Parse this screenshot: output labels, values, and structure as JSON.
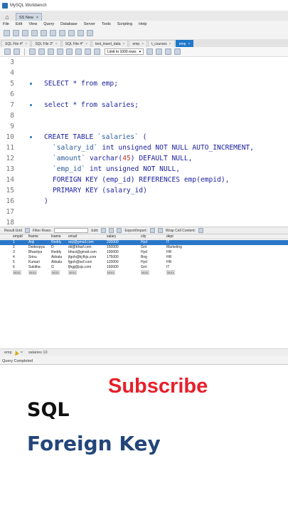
{
  "window": {
    "title": "MySQL Workbench"
  },
  "connection_tab": {
    "label": "SS New",
    "close": "×"
  },
  "menu": [
    "File",
    "Edit",
    "View",
    "Query",
    "Database",
    "Server",
    "Tools",
    "Scripting",
    "Help"
  ],
  "editor_tabs": [
    {
      "label": "SQL File 4*",
      "active": false
    },
    {
      "label": "SQL File 3*",
      "active": false
    },
    {
      "label": "SQL File 4*",
      "active": false
    },
    {
      "label": "test_insert_data",
      "active": false
    },
    {
      "label": "emp",
      "active": false
    },
    {
      "label": "t_courses",
      "active": false
    },
    {
      "label": "emp",
      "active": true
    }
  ],
  "limit_select": {
    "value": "Limit to 1000 rows"
  },
  "editor": {
    "lines": [
      {
        "n": "3",
        "marker": false,
        "segments": []
      },
      {
        "n": "4",
        "marker": false,
        "segments": []
      },
      {
        "n": "5",
        "marker": true,
        "segments": [
          [
            "SELECT * from emp;",
            "kw"
          ]
        ]
      },
      {
        "n": "6",
        "marker": false,
        "segments": []
      },
      {
        "n": "7",
        "marker": true,
        "segments": [
          [
            "select * from salaries;",
            "kw"
          ]
        ]
      },
      {
        "n": "8",
        "marker": false,
        "segments": []
      },
      {
        "n": "9",
        "marker": false,
        "segments": []
      },
      {
        "n": "10",
        "marker": true,
        "segments": [
          [
            "CREATE TABLE ",
            "kw"
          ],
          [
            "`salaries`",
            "str"
          ],
          [
            " (",
            "kw"
          ]
        ]
      },
      {
        "n": "11",
        "marker": false,
        "indent": true,
        "segments": [
          [
            "`salary_id`",
            "str"
          ],
          [
            " int unsigned NOT NULL AUTO_INCREMENT,",
            "kw"
          ]
        ]
      },
      {
        "n": "12",
        "marker": false,
        "indent": true,
        "segments": [
          [
            "`amount`",
            "str"
          ],
          [
            " varchar(",
            "kw"
          ],
          [
            "45",
            "num"
          ],
          [
            ") DEFAULT NULL,",
            "kw"
          ]
        ]
      },
      {
        "n": "13",
        "marker": false,
        "indent": true,
        "segments": [
          [
            "`emp_id`",
            "str"
          ],
          [
            " int unsigned NOT NULL,",
            "kw"
          ]
        ]
      },
      {
        "n": "14",
        "marker": false,
        "indent": true,
        "segments": [
          [
            "FOREIGN KEY (emp_id) REFERENCES emp(empid),",
            "kw"
          ]
        ]
      },
      {
        "n": "15",
        "marker": false,
        "indent": true,
        "segments": [
          [
            "PRIMARY KEY (salary_id)",
            "kw"
          ]
        ]
      },
      {
        "n": "16",
        "marker": false,
        "segments": [
          [
            ")",
            "kw"
          ]
        ]
      },
      {
        "n": "17",
        "marker": false,
        "segments": []
      },
      {
        "n": "18",
        "marker": false,
        "segments": []
      }
    ]
  },
  "result_toolbar": {
    "result_grid": "Result Grid",
    "filter_rows": "Filter Rows:",
    "edit": "Edit:",
    "export_import": "Export/Import:",
    "wrap": "Wrap Cell Content:"
  },
  "grid": {
    "columns": [
      "empid",
      "fname",
      "lname",
      "email",
      "salary",
      "city",
      "dept"
    ],
    "rows": [
      [
        "1",
        "Anji",
        "Reddy",
        "anji@gmail.com",
        "200000",
        "Hyd",
        "IT"
      ],
      [
        "2",
        "Dedeepya",
        "D",
        "dd@trfasf.com",
        "150000",
        "Gnt",
        "Marketing"
      ],
      [
        "3",
        "Bhavitya",
        "Reddy",
        "bhavi@gmail.com",
        "100000",
        "Hyd",
        "HR"
      ],
      [
        "4",
        "Srinu",
        "Akkala",
        "jfgoh@kj;fkjs.com",
        "175000",
        "Bng",
        "HR"
      ],
      [
        "5",
        "Kumari",
        "Akkala",
        "fjgoh@sof.com",
        "120000",
        "Hyd",
        "HR"
      ],
      [
        "6",
        "Sukitha",
        "G",
        "fjhgj@jsjs.com",
        "150000",
        "Gnt",
        "IT"
      ]
    ],
    "null_label": "NULL",
    "selected_row": 0
  },
  "bottom_tabs": [
    {
      "label": "emp",
      "close": "×"
    },
    {
      "label": "salaries 10",
      "close": ""
    }
  ],
  "status": "Query Completed",
  "overlay": {
    "subscribe": "Subscribe",
    "line1": "SQL",
    "line2": "Foreign Key"
  },
  "colors": {
    "accent": "#1f78c8",
    "subscribe": "#e8202a",
    "caption": "#23467a"
  }
}
